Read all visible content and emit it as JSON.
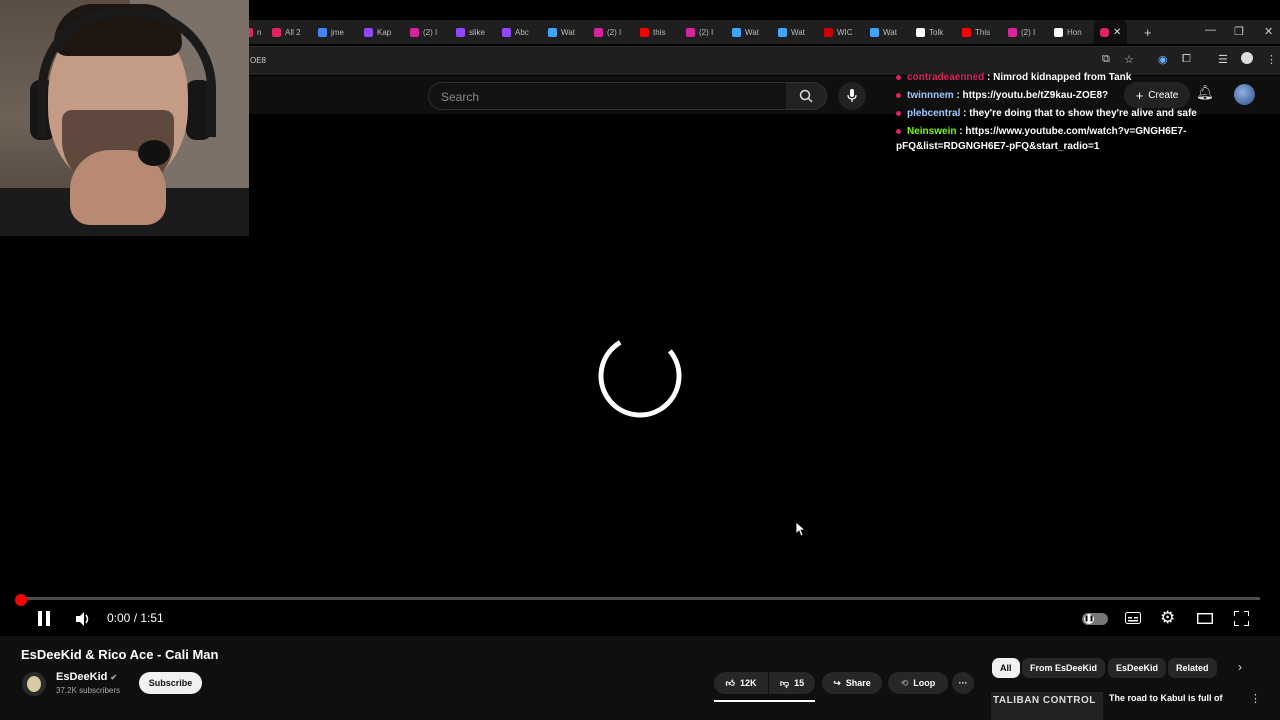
{
  "browser": {
    "tabs": [
      {
        "label": "n",
        "color": "#e0245e"
      },
      {
        "label": "All 2",
        "color": "#e0245e"
      },
      {
        "label": "jme",
        "color": "#4285f4"
      },
      {
        "label": "Kap",
        "color": "#9146ff"
      },
      {
        "label": "(2) I",
        "color": "#d6249f"
      },
      {
        "label": "slike",
        "color": "#9146ff"
      },
      {
        "label": "Abc",
        "color": "#9146ff"
      },
      {
        "label": "Wat",
        "color": "#3ea6ff"
      },
      {
        "label": "(2) I",
        "color": "#d6249f"
      },
      {
        "label": "this",
        "color": "#ff0000"
      },
      {
        "label": "(2) I",
        "color": "#d6249f"
      },
      {
        "label": "Wat",
        "color": "#3ea6ff"
      },
      {
        "label": "Wat",
        "color": "#3ea6ff"
      },
      {
        "label": "WIC",
        "color": "#cc0000"
      },
      {
        "label": "Wat",
        "color": "#3ea6ff"
      },
      {
        "label": "Tolk",
        "color": "#ffffff"
      },
      {
        "label": "This",
        "color": "#ff0000"
      },
      {
        "label": "(2) I",
        "color": "#d6249f"
      },
      {
        "label": "Hon",
        "color": "#ffffff"
      }
    ],
    "active_tab_icon": "youtube-icon",
    "url_fragment": "OE8"
  },
  "youtube_header": {
    "search_placeholder": "Search",
    "create_label": "Create"
  },
  "chat": [
    {
      "user": "contradeaenned",
      "user_color": "#e0245e",
      "message": ": Nimrod kidnapped from Tank"
    },
    {
      "user": "twinnnem",
      "user_color": "#a0c4ff",
      "message": ": https://youtu.be/tZ9kau-ZOE8?"
    },
    {
      "user": "plebcentral",
      "user_color": "#a0c4ff",
      "message": ": they're doing that to show they're alive and safe"
    },
    {
      "user": "Neinswein",
      "user_color": "#7cfc00",
      "message": ": https://www.youtube.com/watch?v=GNGH6E7-pFQ&list=RDGNGH6E7-pFQ&start_radio=1"
    }
  ],
  "player": {
    "time_display": "0:00 / 1:51",
    "progress_fraction": 0.0,
    "autoplay_on": false
  },
  "video": {
    "title": "EsDeeKid & Rico Ace - Cali Man",
    "channel": "EsDeeKid",
    "subscribers": "37.2K subscribers",
    "subscribe_label": "Subscribe",
    "likes": "12K",
    "dislikes": "15",
    "share_label": "Share",
    "loop_label": "Loop",
    "more_label": "···"
  },
  "related": {
    "chips": [
      "All",
      "From EsDeeKid",
      "EsDeeKid",
      "Related"
    ],
    "selected_chip": "All",
    "first_thumb_text": "TALIBAN CONTROL",
    "first_title": "The road to Kabul is full of"
  },
  "colors": {
    "accent_red": "#ff0000",
    "bg": "#0f0f0f"
  }
}
